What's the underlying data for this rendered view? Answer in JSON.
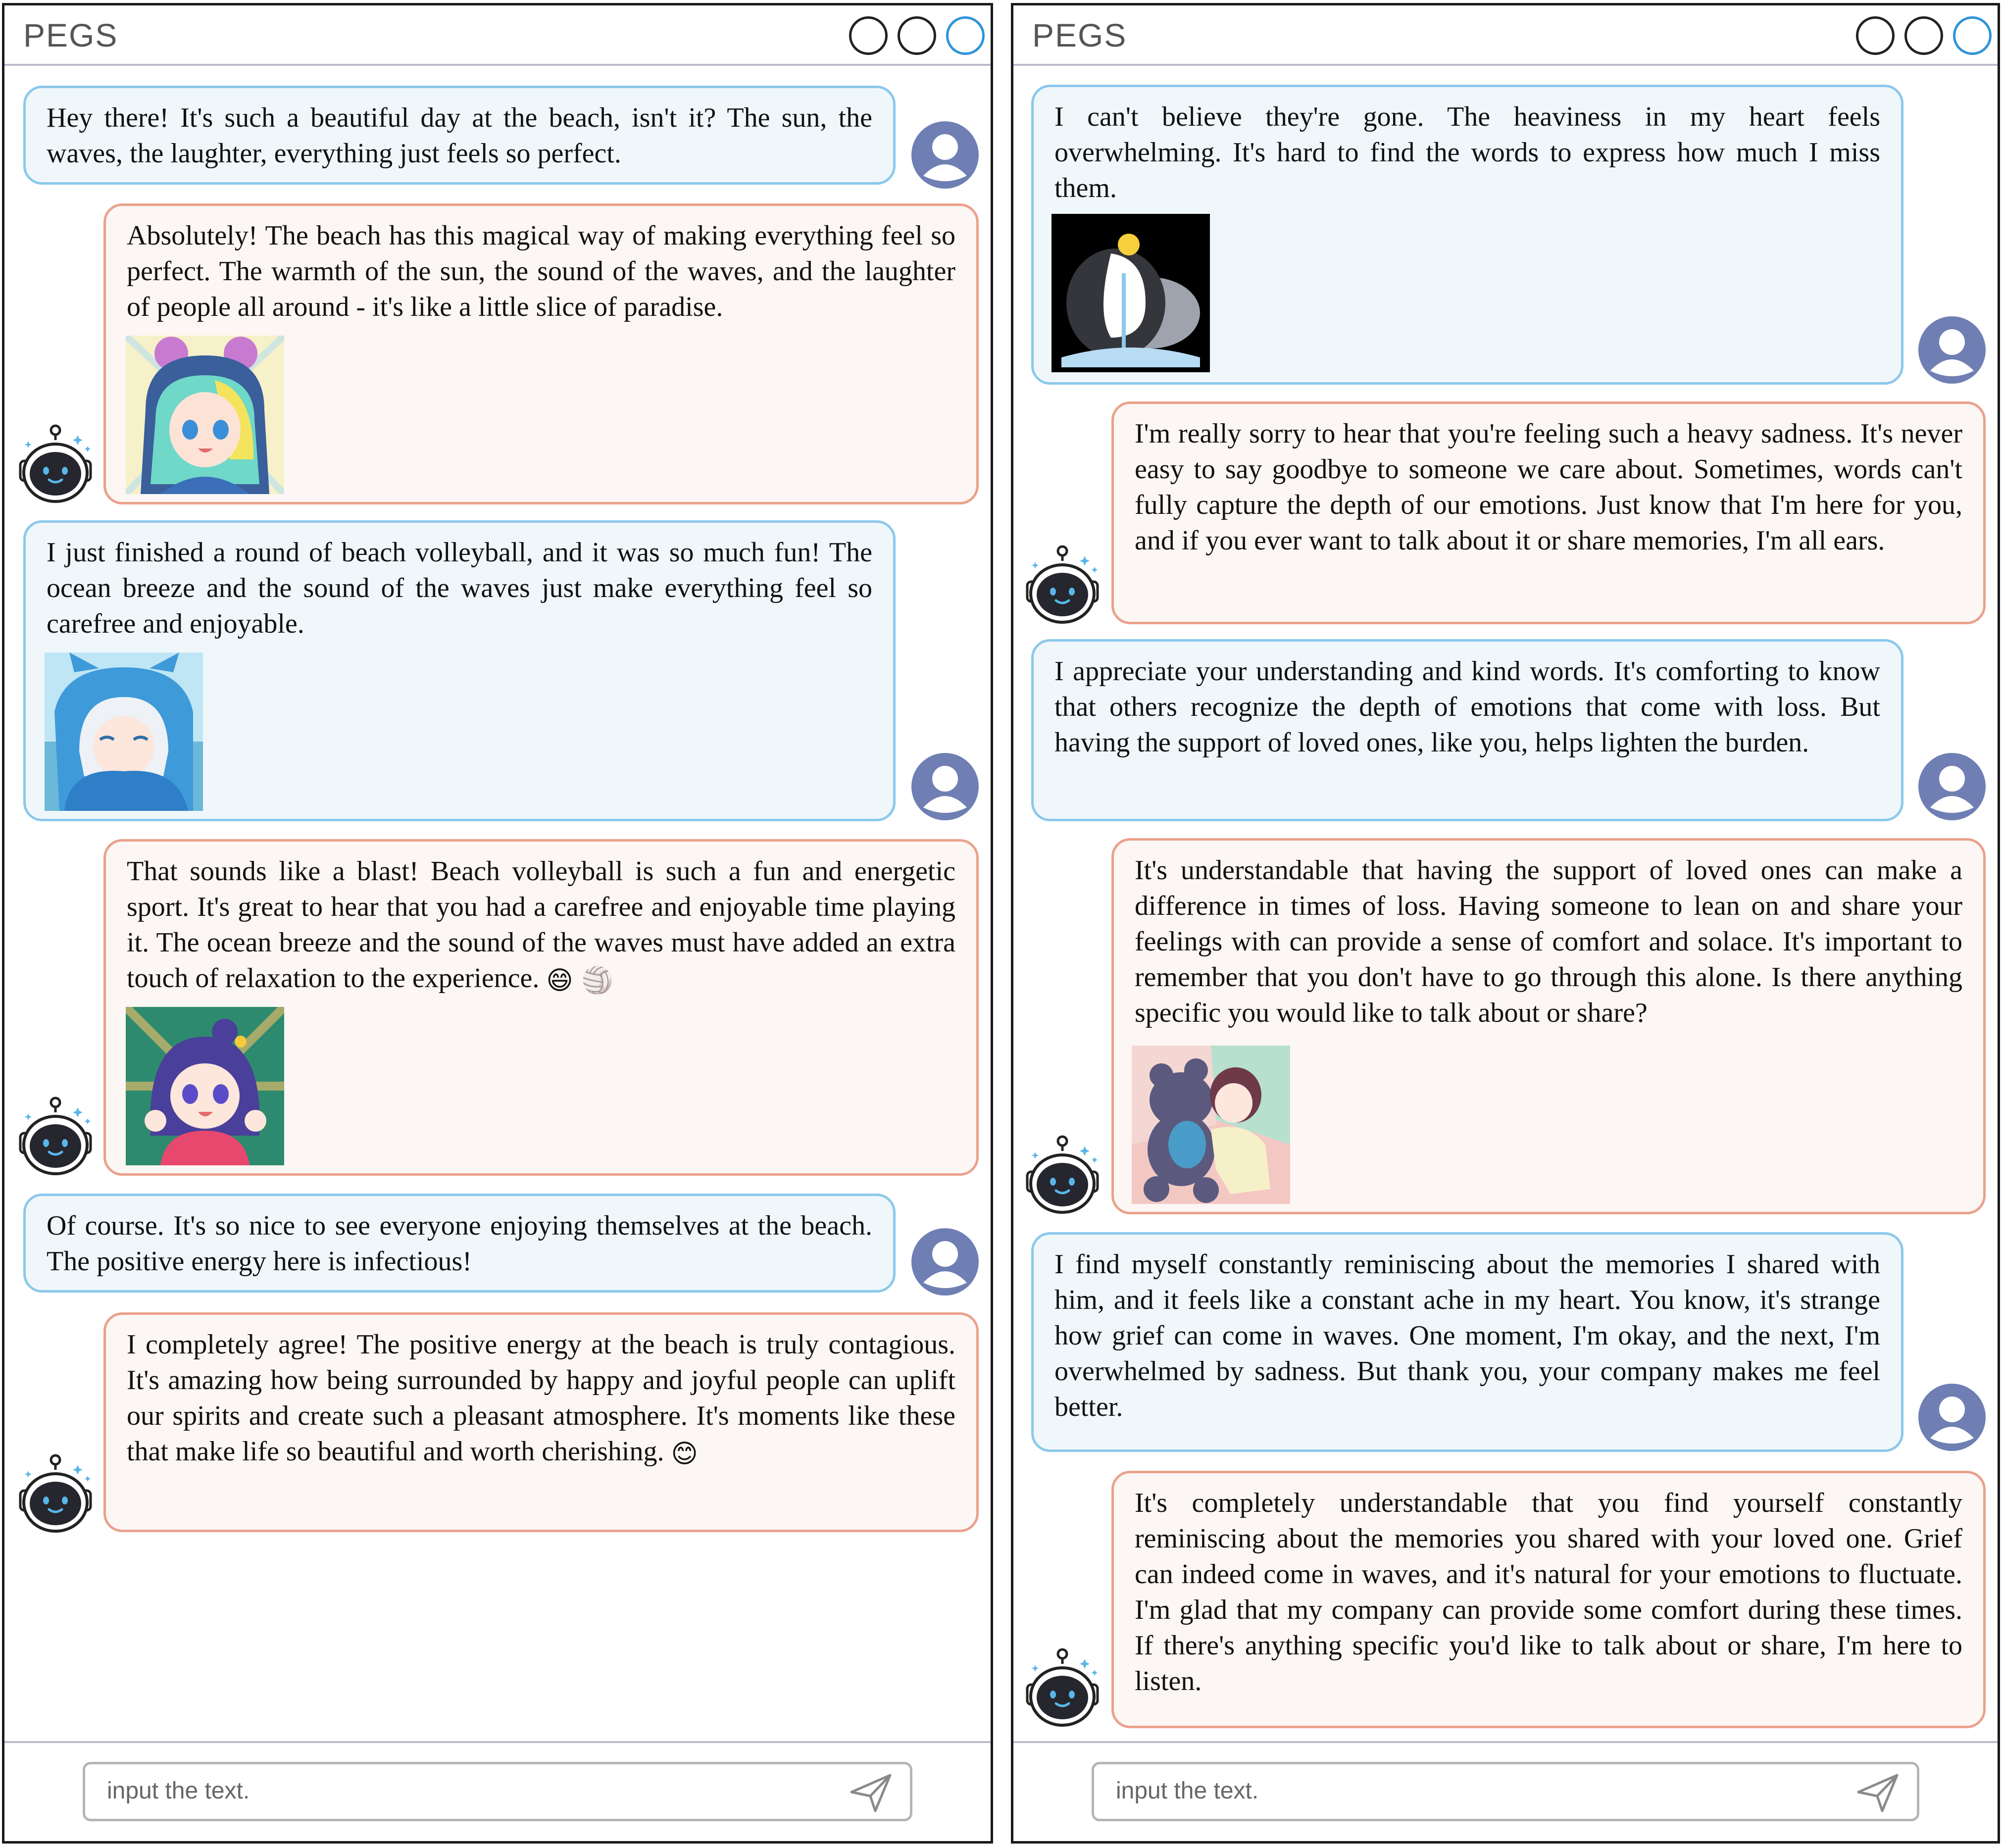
{
  "windows": [
    {
      "app_title": "PEGS",
      "input": {
        "placeholder": "input the text."
      },
      "messages": [
        {
          "role": "user",
          "text": "Hey there! It's such a beautiful day at the beach, isn't it? The sun, the waves, the laughter, everything just feels so perfect."
        },
        {
          "role": "bot",
          "text": "Absolutely! The beach has this magical way of making everything feel so perfect. The warmth of the sun, the sound of the waves, and the laughter of people all around - it's like a little slice of paradise.",
          "image": "anime-girl-mouse-hood-sticker"
        },
        {
          "role": "user",
          "text": "I just finished a round of beach volleyball, and it was so much fun! The ocean breeze and the sound of the waves just make everything feel so carefree and enjoyable.",
          "image": "anime-girl-blue-hoodie-sticker"
        },
        {
          "role": "bot",
          "text": "That sounds like a blast! Beach volleyball is such a fun and energetic sport. It's great to hear that you had a carefree and enjoyable time playing it. The ocean breeze and the sound of the waves must have added an extra touch of relaxation to the experience.",
          "emoji": "😄 🏐",
          "image": "anime-girl-cheering-sticker"
        },
        {
          "role": "user",
          "text": "Of course. It's so nice to see everyone enjoying themselves at the beach. The positive energy here is infectious!"
        },
        {
          "role": "bot",
          "text": "I completely agree! The positive energy at the beach is truly contagious. It's amazing how being surrounded by happy and joyful people can uplift our spirits and create such a pleasant atmosphere. It's moments like these that make life so beautiful and worth cherishing.",
          "emoji": "😊"
        }
      ]
    },
    {
      "app_title": "PEGS",
      "input": {
        "placeholder": "input the text."
      },
      "messages": [
        {
          "role": "user",
          "text": "I can't believe they're gone. The heaviness in my heart feels overwhelming. It's hard to find the words to express how much I miss them.",
          "image": "crying-penguin-sticker"
        },
        {
          "role": "bot",
          "text": "I'm really sorry to hear that you're feeling such a heavy sadness. It's never easy to say goodbye to someone we care about. Sometimes, words can't fully capture the depth of our emotions. Just know that I'm here for you, and if you ever want to talk about it or share memories, I'm all ears."
        },
        {
          "role": "user",
          "text": "I appreciate your understanding and kind words. It's comforting to know that others recognize the depth of emotions that come with loss. But having the support of loved ones, like you, helps lighten the burden."
        },
        {
          "role": "bot",
          "text": "It's understandable that having the support of loved ones can make a difference in times of loss. Having someone to lean on and share your feelings with can provide a sense of comfort and solace. It's important to remember that you don't have to go through this alone. Is there anything specific you would like to talk about or share?",
          "image": "girl-hugging-teddy-bear-sticker"
        },
        {
          "role": "user",
          "text": "I find myself constantly reminiscing about the memories I shared with him, and it feels like a constant ache in my heart. You know, it's strange how grief can come in waves. One moment, I'm okay, and the next, I'm overwhelmed by sadness. But thank you, your company makes me feel better."
        },
        {
          "role": "bot",
          "text": "It's completely understandable that you find yourself constantly reminiscing about the memories you shared with your loved one. Grief can indeed come in waves, and it's natural for your emotions to fluctuate. I'm glad that my company can provide some comfort during these times. If there's anything specific you'd like to talk about or share, I'm here to listen."
        }
      ]
    }
  ],
  "icons": {
    "user_avatar": "user-avatar-icon",
    "bot_avatar": "robot-avatar-icon",
    "send": "send-icon",
    "window_controls": "window-control-icon"
  },
  "colors": {
    "user_bubble_bg": "#eff7fb",
    "user_bubble_border": "#8cc8eb",
    "bot_bubble_bg": "#fcf6f4",
    "bot_bubble_border": "#eaa18b",
    "avatar": "#6f7fb4",
    "accent_control": "#2f93d8"
  }
}
